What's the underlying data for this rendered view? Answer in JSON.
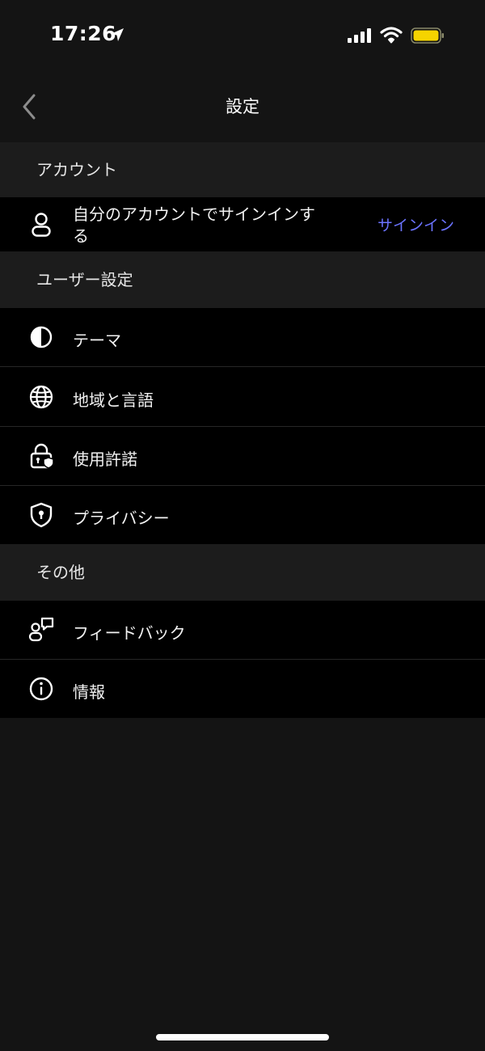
{
  "status_bar": {
    "time": "17:26",
    "battery_color": "#f5d400"
  },
  "nav": {
    "title": "設定",
    "back_icon": "chevron-left-icon"
  },
  "sections": {
    "account": {
      "header": "アカウント",
      "row": {
        "label": "自分のアカウントでサインインする",
        "action_label": "サインイン",
        "icon": "user-icon"
      }
    },
    "user_settings": {
      "header": "ユーザー設定",
      "items": [
        {
          "label": "テーマ",
          "icon": "contrast-icon"
        },
        {
          "label": "地域と言語",
          "icon": "globe-icon"
        },
        {
          "label": "使用許諾",
          "icon": "lock-shield-icon"
        },
        {
          "label": "プライバシー",
          "icon": "shield-lock-icon"
        }
      ]
    },
    "other": {
      "header": "その他",
      "items": [
        {
          "label": "フィードバック",
          "icon": "feedback-icon"
        },
        {
          "label": "情報",
          "icon": "info-icon"
        }
      ]
    }
  },
  "colors": {
    "background": "#141414",
    "section_header_bg": "#1c1c1c",
    "row_bg": "#000000",
    "link": "#6b73ff"
  }
}
